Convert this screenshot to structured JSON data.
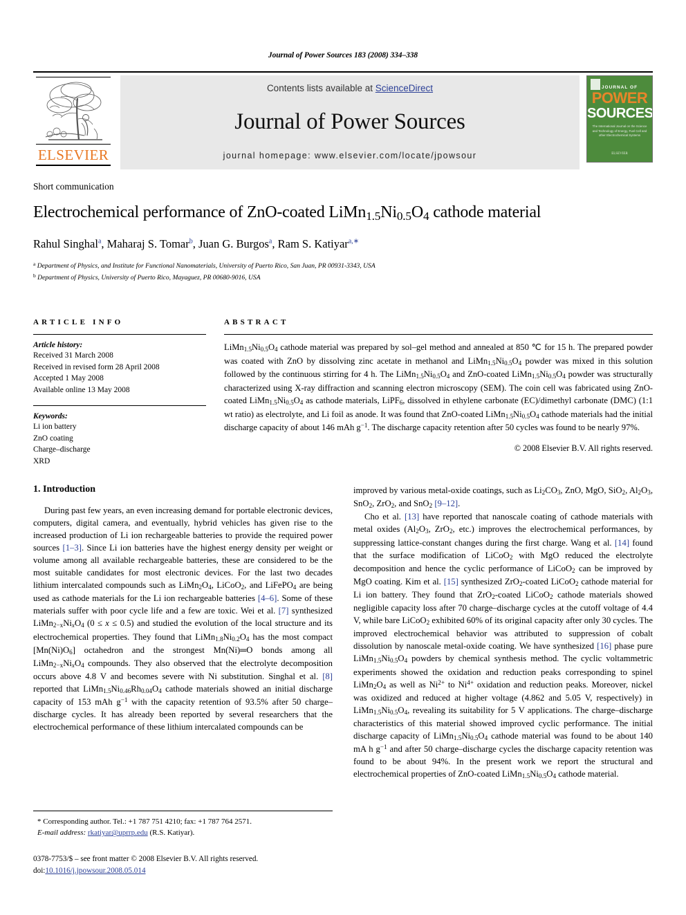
{
  "running_head": "Journal of Power Sources 183 (2008) 334–338",
  "masthead": {
    "contents_prefix": "Contents lists available at ",
    "sciencedirect": "ScienceDirect",
    "journal_title": "Journal of Power Sources",
    "homepage": "journal homepage: www.elsevier.com/locate/jpowsour",
    "publisher_logo_text": "ELSEVIER",
    "cover": {
      "journal_of": "JOURNAL OF",
      "power": "POWER",
      "sources": "SOURCES",
      "subtitle": "The International Journal on the Science and Technology of Energy, Fuel Cell and other Electrochemical Systems",
      "footer": "ELSEVIER"
    },
    "accent_link_color": "#2b3f96",
    "band_color": "#e8e8e8",
    "elsevier_orange": "#E87722",
    "cover_green": "#4d8b3c"
  },
  "title_block": {
    "doctype": "Short communication",
    "title_html": "Electrochemical performance of ZnO-coated LiMn<sub>1.5</sub>Ni<sub>0.5</sub>O<sub>4</sub> cathode material",
    "title_plain": "Electrochemical performance of ZnO-coated LiMn1.5Ni0.5O4 cathode material",
    "authors_html": "Rahul Singhal<sup class=\"affil-mark\">a</sup>, Maharaj S. Tomar<sup class=\"affil-mark\">b</sup>, Juan G. Burgos<sup class=\"affil-mark\">a</sup>, Ram S. Katiyar<sup class=\"affil-mark\">a,∗</sup>",
    "affiliations": [
      "Department of Physics, and Institute for Functional Nanomaterials, University of Puerto Rico, San Juan, PR 00931-3343, USA",
      "Department of Physics, University of Puerto Rico, Mayaguez, PR 00680-9016, USA"
    ],
    "affiliation_marks": [
      "a",
      "b"
    ]
  },
  "article_info": {
    "heading": "ARTICLE INFO",
    "history_label": "Article history:",
    "history": [
      "Received 31 March 2008",
      "Received in revised form 28 April 2008",
      "Accepted 1 May 2008",
      "Available online 13 May 2008"
    ],
    "keywords_label": "Keywords:",
    "keywords": [
      "Li ion battery",
      "ZnO coating",
      "Charge–discharge",
      "XRD"
    ]
  },
  "abstract": {
    "heading": "ABSTRACT",
    "body_html": "LiMn<sub>1.5</sub>Ni<sub>0.5</sub>O<sub>4</sub> cathode material was prepared by sol–gel method and annealed at 850 &#8451; for 15 h. The prepared powder was coated with ZnO by dissolving zinc acetate in methanol and LiMn<sub>1.5</sub>Ni<sub>0.5</sub>O<sub>4</sub> powder was mixed in this solution followed by the continuous stirring for 4 h. The LiMn<sub>1.5</sub>Ni<sub>0.5</sub>O<sub>4</sub> and ZnO-coated LiMn<sub>1.5</sub>Ni<sub>0.5</sub>O<sub>4</sub> powder was structurally characterized using X-ray diffraction and scanning electron microscopy (SEM). The coin cell was fabricated using ZnO-coated LiMn<sub>1.5</sub>Ni<sub>0.5</sub>O<sub>4</sub> as cathode materials, LiPF<sub>6</sub>, dissolved in ethylene carbonate (EC)/dimethyl carbonate (DMC) (1:1 wt ratio) as electrolyte, and Li foil as anode. It was found that ZnO-coated LiMn<sub>1.5</sub>Ni<sub>0.5</sub>O<sub>4</sub> cathode materials had the initial discharge capacity of about 146 mAh g<sup>−1</sup>. The discharge capacity retention after 50 cycles was found to be nearly 97%.",
    "copyright": "© 2008 Elsevier B.V. All rights reserved."
  },
  "body": {
    "section_number_title": "1. Introduction",
    "left_paragraphs": [
      "During past few years, an even increasing demand for portable electronic devices, computers, digital camera, and eventually, hybrid vehicles has given rise to the increased production of Li ion rechargeable batteries to provide the required power sources <span class=\"ref\">[1–3]</span>. Since Li ion batteries have the highest energy density per weight or volume among all available rechargeable batteries, these are considered to be the most suitable candidates for most electronic devices. For the last two decades lithium intercalated compounds such as LiMn<sub>2</sub>O<sub>4</sub>, LiCoO<sub>2</sub>, and LiFePO<sub>4</sub> are being used as cathode materials for the Li ion rechargeable batteries <span class=\"ref\">[4–6]</span>. Some of these materials suffer with poor cycle life and a few are toxic. Wei et al. <span class=\"ref\">[7]</span> synthesized LiMn<sub>2−x</sub>Ni<sub><i>x</i></sub>O<sub>4</sub> (0 ≤ <i>x</i> ≤ 0.5) and studied the evolution of the local structure and its electrochemical properties. They found that LiMn<sub>1.8</sub>Ni<sub>0.2</sub>O<sub>4</sub> has the most compact [Mn(Ni)O<sub>6</sub>] octahedron and the strongest Mn(Ni)═O bonds among all LiMn<sub>2−x</sub>Ni<sub><i>x</i></sub>O<sub>4</sub> compounds. They also observed that the electrolyte decomposition occurs above 4.8 V and becomes severe with Ni substitution. Singhal et al. <span class=\"ref\">[8]</span> reported that LiMn<sub>1.5</sub>Ni<sub>0.46</sub>Rh<sub>0.04</sub>O<sub>4</sub> cathode materials showed an initial discharge capacity of 153 mAh g<sup>−1</sup> with the capacity retention of 93.5% after 50 charge–discharge cycles. It has already been reported by several researchers that the electrochemical performance of these lithium intercalated compounds can be"
    ],
    "right_paragraphs": [
      "improved by various metal-oxide coatings, such as Li<sub>2</sub>CO<sub>3</sub>, ZnO, MgO, SiO<sub>2</sub>, Al<sub>2</sub>O<sub>3</sub>, SnO<sub>2</sub>, ZrO<sub>2</sub>, and SnO<sub>2</sub> <span class=\"ref\">[9–12]</span>.",
      "Cho et al. <span class=\"ref\">[13]</span> have reported that nanoscale coating of cathode materials with metal oxides (Al<sub>2</sub>O<sub>3</sub>, ZrO<sub>2</sub>, etc.) improves the electrochemical performances, by suppressing lattice-constant changes during the first charge. Wang et al. <span class=\"ref\">[14]</span> found that the surface modification of LiCoO<sub>2</sub> with MgO reduced the electrolyte decomposition and hence the cyclic performance of LiCoO<sub>2</sub> can be improved by MgO coating. Kim et al. <span class=\"ref\">[15]</span> synthesized ZrO<sub>2</sub>-coated LiCoO<sub>2</sub> cathode material for Li ion battery. They found that ZrO<sub>2</sub>-coated LiCoO<sub>2</sub> cathode materials showed negligible capacity loss after 70 charge–discharge cycles at the cutoff voltage of 4.4 V, while bare LiCoO<sub>2</sub> exhibited 60% of its original capacity after only 30 cycles. The improved electrochemical behavior was attributed to suppression of cobalt dissolution by nanoscale metal-oxide coating. We have synthesized <span class=\"ref\">[16]</span> phase pure LiMn<sub>1.5</sub>Ni<sub>0.5</sub>O<sub>4</sub> powders by chemical synthesis method. The cyclic voltammetric experiments showed the oxidation and reduction peaks corresponding to spinel LiMn<sub>2</sub>O<sub>4</sub> as well as Ni<sup>2+</sup> to Ni<sup>4+</sup> oxidation and reduction peaks. Moreover, nickel was oxidized and reduced at higher voltage (4.862 and 5.05 V, respectively) in LiMn<sub>1.5</sub>Ni<sub>0.5</sub>O<sub>4</sub>, revealing its suitability for 5 V applications. The charge–discharge characteristics of this material showed improved cyclic performance. The initial discharge capacity of LiMn<sub>1.5</sub>Ni<sub>0.5</sub>O<sub>4</sub> cathode material was found to be about 140 mA h g<sup>−1</sup> and after 50 charge–discharge cycles the discharge capacity retention was found to be about 94%. In the present work we report the structural and electrochemical properties of ZnO-coated LiMn<sub>1.5</sub>Ni<sub>0.5</sub>O<sub>4</sub> cathode material."
    ]
  },
  "footnotes": {
    "corresponding": "* Corresponding author. Tel.: +1 787 751 4210; fax: +1 787 764 2571.",
    "email_label": "E-mail address:",
    "email": "rkatiyar@uprrp.edu",
    "email_suffix": "(R.S. Katiyar).",
    "issn_line": "0378-7753/$ – see front matter © 2008 Elsevier B.V. All rights reserved.",
    "doi_label": "doi:",
    "doi": "10.1016/j.jpowsour.2008.05.014"
  }
}
